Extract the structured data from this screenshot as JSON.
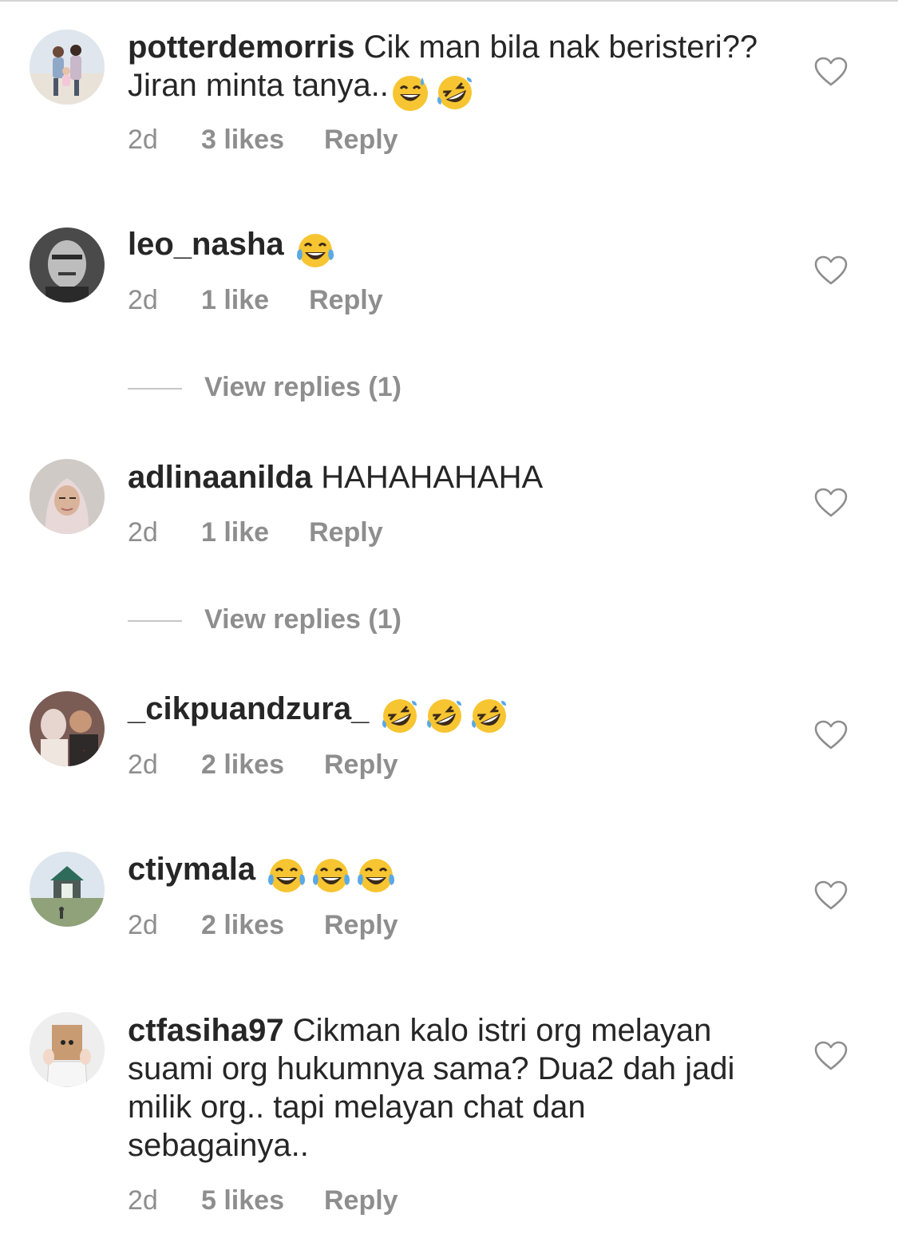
{
  "comments": [
    {
      "username": "potterdemorris",
      "text": "Cik man bila nak beristeri?? Jiran minta tanya..",
      "emojis": [
        "grinning-sweat-emoji",
        "rofl-emoji"
      ],
      "time": "2d",
      "likes": "3 likes",
      "reply": "Reply"
    },
    {
      "username": "leo_nasha",
      "text": "",
      "emojis": [
        "tears-of-joy-emoji"
      ],
      "time": "2d",
      "likes": "1 like",
      "reply": "Reply",
      "view_replies": "View replies (1)"
    },
    {
      "username": "adlinaanilda",
      "text": "HAHAHAHAHA",
      "emojis": [],
      "time": "2d",
      "likes": "1 like",
      "reply": "Reply",
      "view_replies": "View replies (1)"
    },
    {
      "username": "_cikpuandzura_",
      "text": "",
      "emojis": [
        "rofl-emoji",
        "rofl-emoji",
        "rofl-emoji"
      ],
      "time": "2d",
      "likes": "2 likes",
      "reply": "Reply"
    },
    {
      "username": "ctiymala",
      "text": "",
      "emojis": [
        "tears-of-joy-emoji",
        "tears-of-joy-emoji",
        "tears-of-joy-emoji"
      ],
      "time": "2d",
      "likes": "2 likes",
      "reply": "Reply"
    },
    {
      "username": "ctfasiha97",
      "text": "Cikman kalo istri org melayan suami org hukumnya sama? Dua2 dah jadi milik org.. tapi melayan chat dan sebagainya..",
      "emojis": [],
      "time": "2d",
      "likes": "5 likes",
      "reply": "Reply"
    }
  ],
  "colors": {
    "primary_text": "#262626",
    "secondary_text": "#8e8e8e",
    "divider": "#c7c7c7",
    "emoji_yellow": "#f7c531",
    "emoji_tear": "#5aa9e6"
  }
}
